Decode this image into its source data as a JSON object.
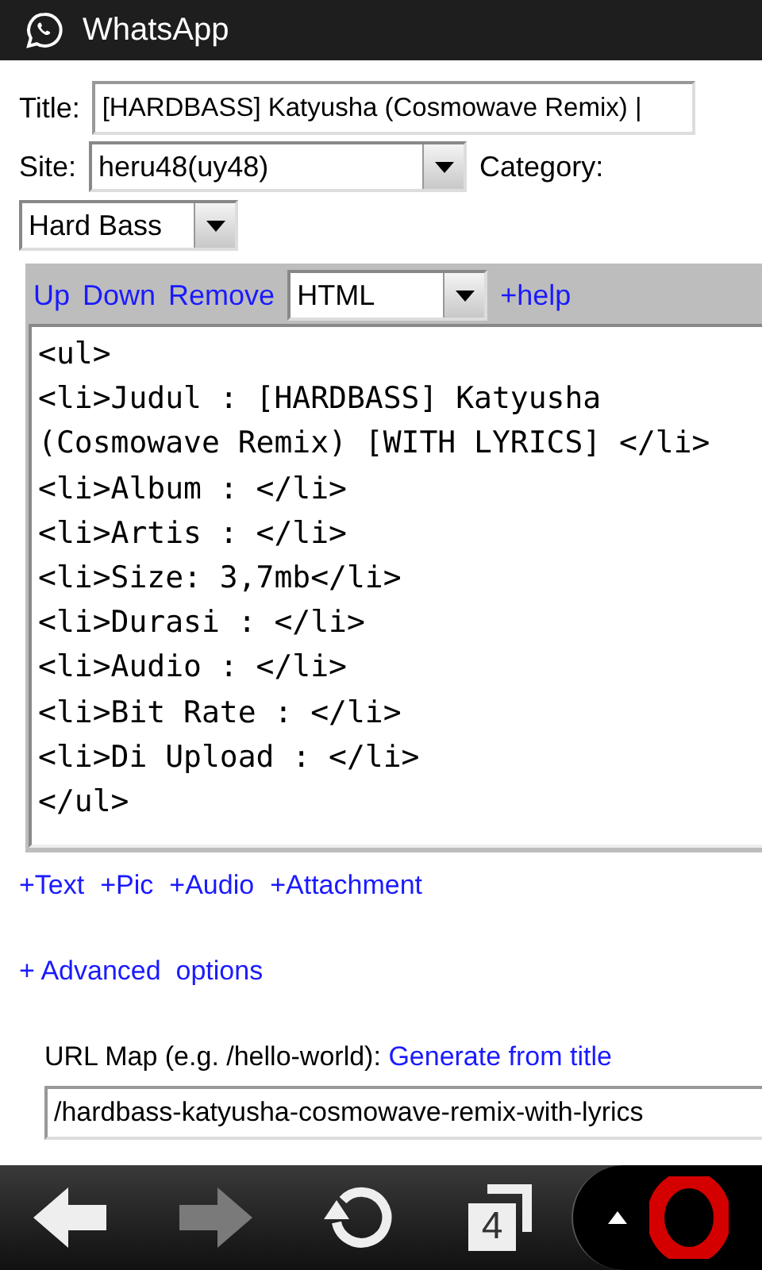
{
  "app_bar": {
    "title": "WhatsApp"
  },
  "form": {
    "title_label": "Title:",
    "title_value": "[HARDBASS] Katyusha (Cosmowave Remix) |",
    "site_label": "Site:",
    "site_value": "heru48(uy48)",
    "category_label": "Category:",
    "category_value": "Hard Bass"
  },
  "editor": {
    "toolbar_links": [
      "Up",
      "Down",
      "Remove"
    ],
    "format_value": "HTML",
    "help_link": "+help",
    "lines": [
      "<ul>",
      "<li>Judul : [HARDBASS] Katyusha (Cosmowave Remix) [WITH LYRICS] </li>",
      "<li>Album : </li>",
      "<li>Artis : </li>",
      "<li>Size: 3,7mb</li>",
      "<li>Durasi : </li>",
      "<li>Audio : </li>",
      "<li>Bit Rate : </li>",
      "<li>Di Upload : </li>",
      "</ul>"
    ]
  },
  "add_links": [
    "+Text",
    "+Pic",
    "+Audio",
    "+Attachment"
  ],
  "advanced_link": "+ Advanced  options",
  "url_map": {
    "label": "URL Map (e.g. /hello-world):",
    "generate_link": "Generate from title",
    "value": "/hardbass-katyusha-cosmowave-remix-with-lyrics"
  },
  "browser_bar": {
    "back_disabled": false,
    "forward_disabled": true,
    "tab_count": "4"
  }
}
